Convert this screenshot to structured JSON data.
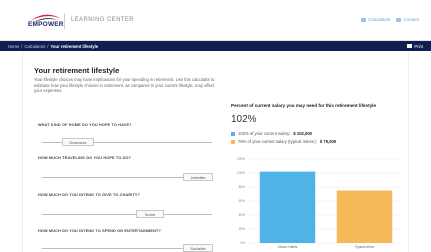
{
  "header": {
    "logo_text": "EMPOWER",
    "section_title": "LEARNING CENTER",
    "links": [
      {
        "label": "Calculators",
        "icon": "calculator-icon"
      },
      {
        "label": "Contact",
        "icon": "contact-icon"
      }
    ]
  },
  "breadcrumb": {
    "items": [
      "Home",
      "Calculators"
    ],
    "separator": "/",
    "current": "Your retirement lifestyle"
  },
  "toolbar": {
    "print_label": "Print",
    "print_icon": "printer-icon"
  },
  "page": {
    "title": "Your retirement lifestyle",
    "intro": "Your lifestyle choices may have implications for your spending in retirement. Use this calculator to estimate how your lifestyle choices in retirement, as compared to your current lifestyle, may affect your expenses."
  },
  "questions": [
    {
      "label": "WHAT KIND OF HOME DO YOU HOPE TO HAVE?",
      "value": "Downsize",
      "level": 0.4
    },
    {
      "label": "HOW MUCH TRAVELING DO YOU HOPE TO DO?",
      "value": "Jetsetter",
      "level": 1.0
    },
    {
      "label": "HOW MUCH DO YOU INTEND TO GIVE TO CHARITY?",
      "value": "Some",
      "level": 0.65
    },
    {
      "label": "HOW MUCH DO YOU INTEND TO SPEND ON ENTERTAINMENT?",
      "value": "Sociable",
      "level": 1.0
    }
  ],
  "results": {
    "title": "Percent of current salary you may need for this retirement lifestyle",
    "big_percent": "102%",
    "legend": [
      {
        "text": "102% of your current salary: ",
        "amount": "$ 102,000",
        "color": "#4fb3e8"
      },
      {
        "text": "75% of your current salary (typical retiree): ",
        "amount": "$ 75,000",
        "color": "#f5b95a"
      }
    ]
  },
  "chart_data": {
    "type": "bar",
    "categories": [
      "Shown Habits",
      "Typical retiree"
    ],
    "values": [
      102,
      75
    ],
    "colors": [
      "#4fb3e8",
      "#f5b95a"
    ],
    "yticks": [
      "0%",
      "20%",
      "40%",
      "60%",
      "80%",
      "100%",
      "120%"
    ],
    "ylim": [
      0,
      120
    ],
    "grid": true
  }
}
